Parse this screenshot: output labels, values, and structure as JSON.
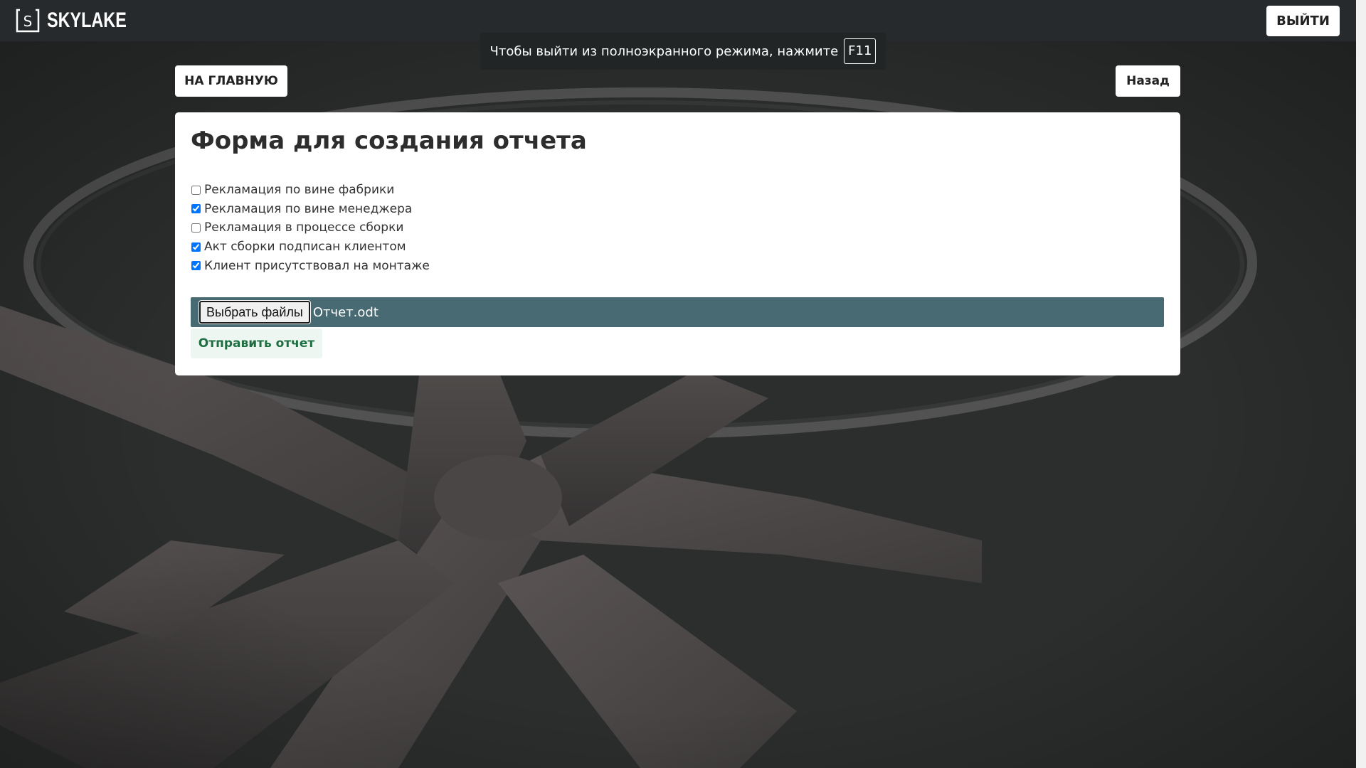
{
  "header": {
    "logo_text": "SKYLAKE",
    "logo_icon": "s-square-icon",
    "logout_label": "ВЫЙТИ"
  },
  "fullscreen_notice": {
    "text": "Чтобы выйти из полноэкранного режима, нажмите",
    "key": "F11"
  },
  "nav": {
    "home_label": "НА ГЛАВНУЮ",
    "back_label": "Назад"
  },
  "form": {
    "title": "Форма для создания отчета",
    "checkboxes": [
      {
        "label": "Рекламация по вине фабрики",
        "checked": false
      },
      {
        "label": "Рекламация по вине менеджера",
        "checked": true
      },
      {
        "label": "Рекламация в процессе сборки",
        "checked": false
      },
      {
        "label": "Акт сборки подписан клиентом",
        "checked": true
      },
      {
        "label": "Клиент присутствовал на монтаже",
        "checked": true
      }
    ],
    "file_button_label": "Выбрать файлы",
    "file_name": "Отчет.odt",
    "submit_label": "Отправить отчет"
  },
  "colors": {
    "topbar": "#262a2c",
    "background": "#2b2d2d",
    "file_bar": "#476a73",
    "submit_text": "#1e6e42",
    "submit_bg": "#edf6f1"
  }
}
